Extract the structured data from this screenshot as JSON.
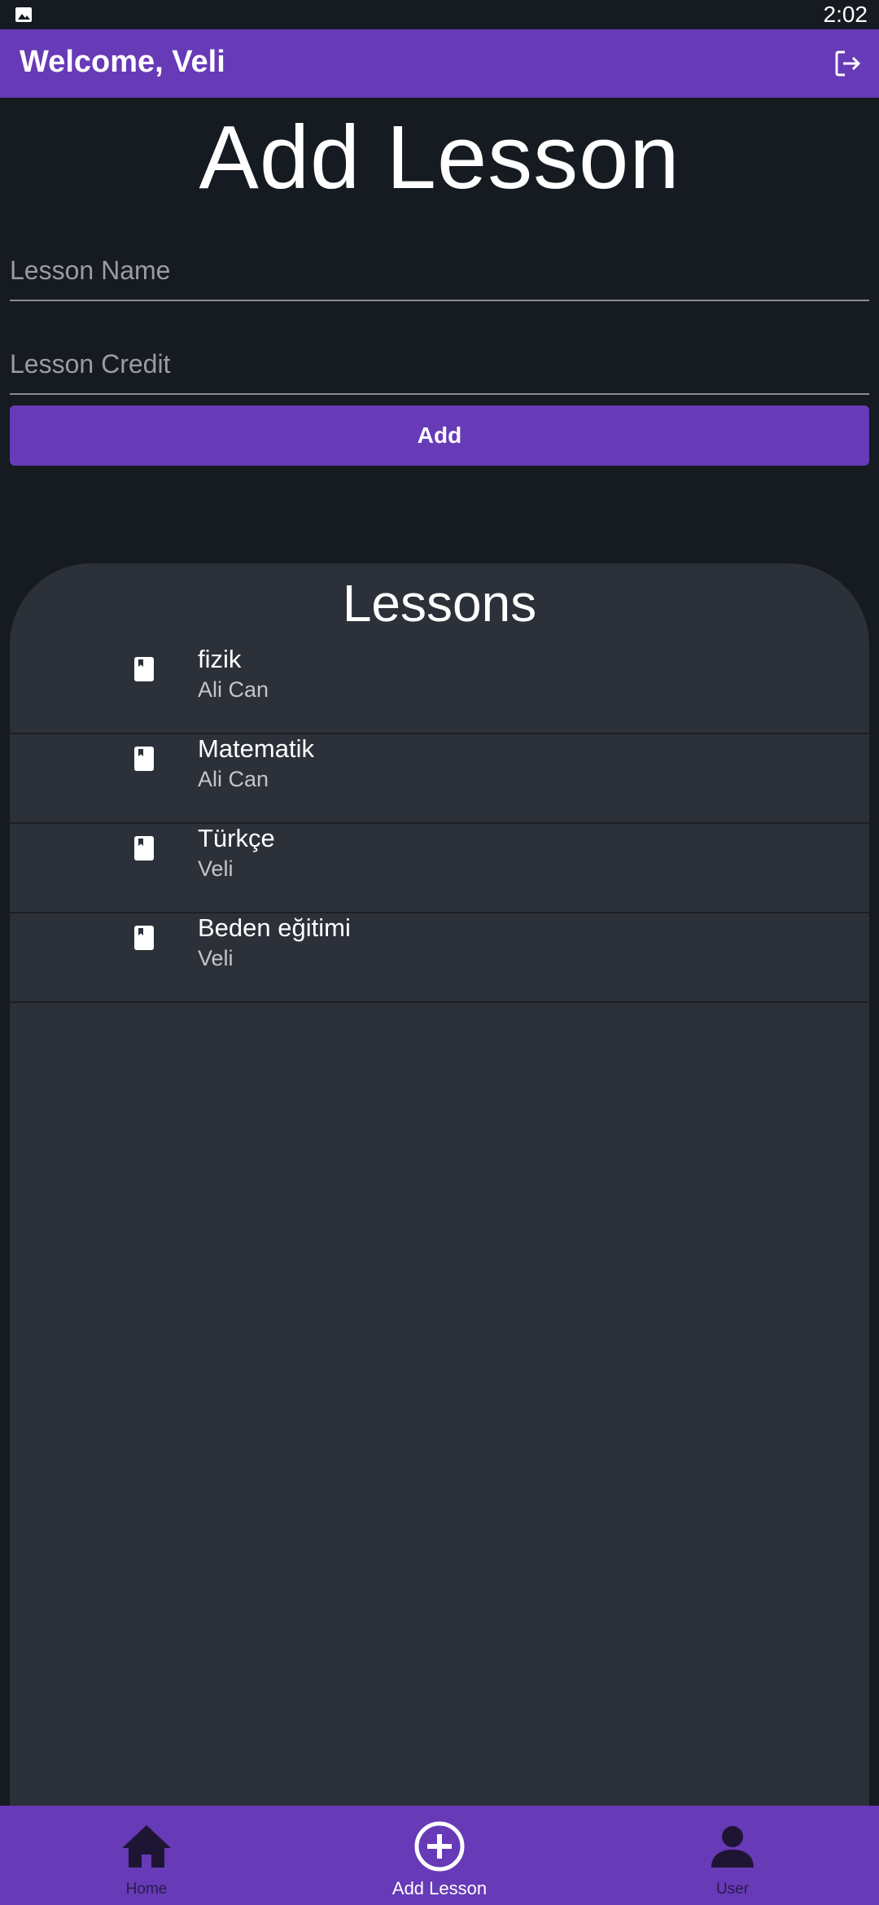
{
  "status_bar": {
    "time": "2:02",
    "notification_icon": "gallery-icon"
  },
  "app_bar": {
    "title": "Welcome, Veli",
    "action_icon": "logout-icon"
  },
  "page": {
    "heading": "Add Lesson"
  },
  "form": {
    "lesson_name": {
      "placeholder": "Lesson Name",
      "value": ""
    },
    "lesson_credit": {
      "placeholder": "Lesson Credit",
      "value": ""
    },
    "add_label": "Add"
  },
  "lessons": {
    "title": "Lessons",
    "items": [
      {
        "name": "fizik",
        "teacher": "Ali Can",
        "icon": "book-icon"
      },
      {
        "name": "Matematik",
        "teacher": "Ali Can",
        "icon": "book-icon"
      },
      {
        "name": "Türkçe",
        "teacher": "Veli",
        "icon": "book-icon"
      },
      {
        "name": "Beden eğitimi",
        "teacher": "Veli",
        "icon": "book-icon"
      }
    ]
  },
  "bottom_nav": {
    "items": [
      {
        "label": "Home",
        "icon": "home-icon",
        "active": false
      },
      {
        "label": "Add Lesson",
        "icon": "add-circle-icon",
        "active": true
      },
      {
        "label": "User",
        "icon": "user-icon",
        "active": false
      }
    ]
  },
  "colors": {
    "primary": "#673ab7",
    "background": "#161a21",
    "panel": "#2c3039"
  }
}
